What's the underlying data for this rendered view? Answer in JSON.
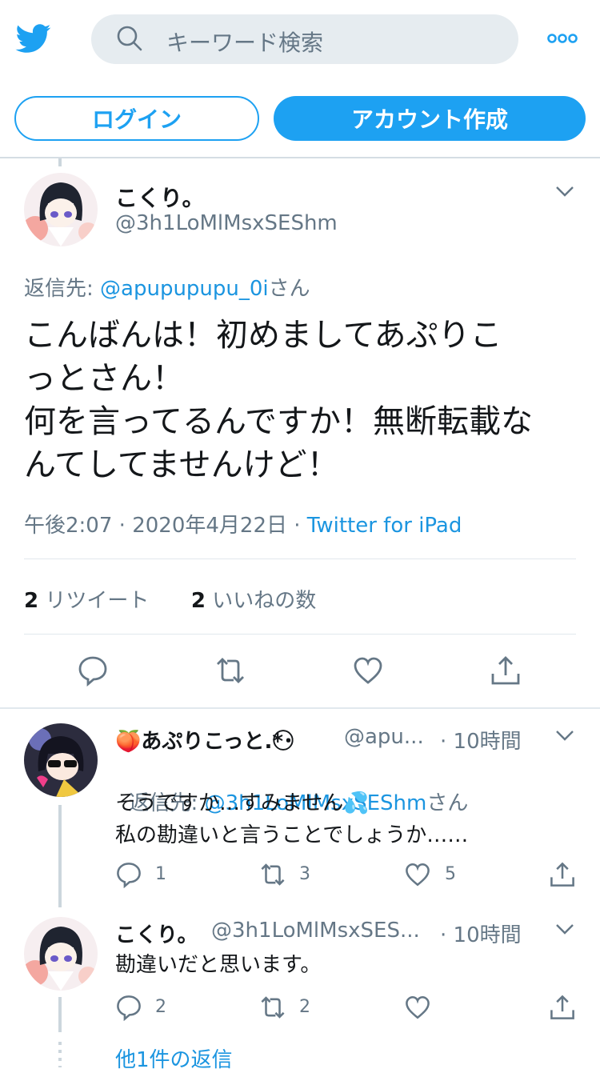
{
  "header": {
    "logo_icon": "twitter-bird-icon",
    "search_placeholder": "キーワード検索",
    "more_icon": "more-dots-icon",
    "login_label": "ログイン",
    "signup_label": "アカウント作成",
    "accent_color": "#1da1f2"
  },
  "main_tweet": {
    "name": "こくり。",
    "handle": "@3h1LoMlMsxSEShm",
    "replying_prefix": "返信先: ",
    "replying_user": "@apupupupu_0i",
    "replying_suffix": "さん",
    "text": "こんばんは！初めましてあぷりこ\nっとさん！\n何を言ってるんですか！無断転載な\nんてしてませんけど！",
    "time": "午後2:07",
    "date": "2020年4月22日",
    "source": "Twitter for iPad",
    "retweet_count": "2",
    "retweet_label": "リツイート",
    "like_count": "2",
    "like_label": "いいねの数"
  },
  "replies": [
    {
      "emoji": "🍑",
      "name": "あぷりこっと.*･",
      "name_tail": "⃝⃝",
      "handle": "@apu...",
      "time": "· 10時間",
      "replying_prefix": "返信先: ",
      "replying_user": "@3h1LoMlMsxSEShm",
      "replying_suffix": "さん",
      "text": "そうですか…すみません💦\n私の勘違いと言うことでしょうか……",
      "reply_count": "1",
      "retweet_count": "3",
      "like_count": "5"
    },
    {
      "name": "こくり。",
      "handle": "@3h1LoMlMsxSES...",
      "time": "· 10時間",
      "text": "勘違いだと思います。",
      "reply_count": "2",
      "retweet_count": "2",
      "like_count": ""
    }
  ],
  "more_replies_label": "他1件の返信"
}
